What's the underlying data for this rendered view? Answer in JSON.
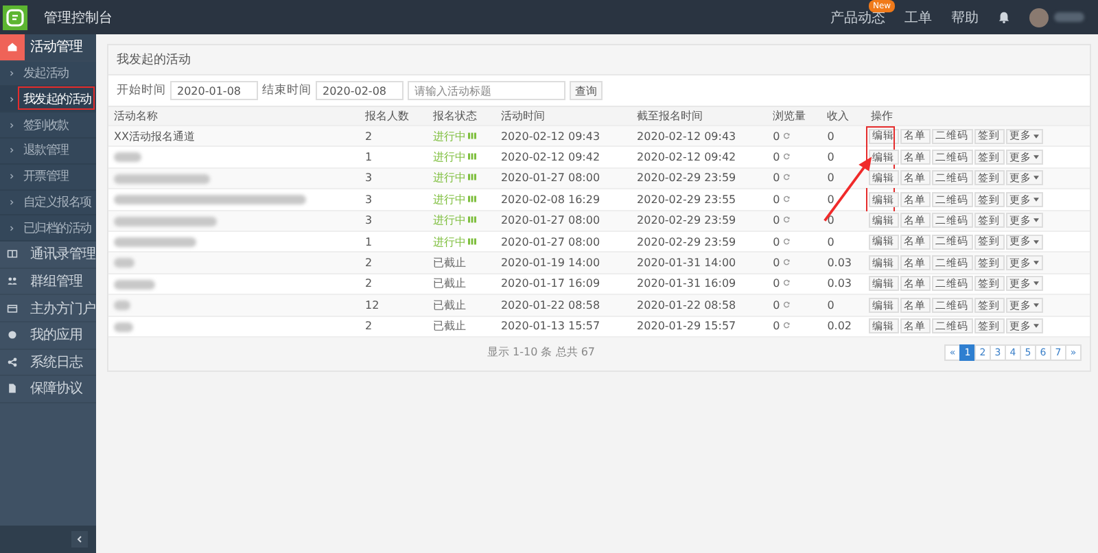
{
  "header": {
    "title": "管理控制台",
    "links": [
      {
        "label": "产品动态",
        "badge": "New"
      },
      {
        "label": "工单"
      },
      {
        "label": "帮助"
      }
    ]
  },
  "sidebar": {
    "items": [
      {
        "label": "活动管理",
        "selected": true,
        "expanded": true,
        "children": [
          {
            "label": "发起活动",
            "selected": false
          },
          {
            "label": "我发起的活动",
            "selected": true
          },
          {
            "label": "签到收款",
            "selected": false
          },
          {
            "label": "退款管理",
            "selected": false
          },
          {
            "label": "开票管理",
            "selected": false
          },
          {
            "label": "自定义报名项",
            "selected": false
          },
          {
            "label": "已归档的活动",
            "selected": false
          }
        ]
      },
      {
        "label": "通讯录管理",
        "selected": false,
        "expanded": false
      },
      {
        "label": "群组管理",
        "selected": false,
        "expanded": false
      },
      {
        "label": "主办方门户",
        "selected": false,
        "expanded": false
      },
      {
        "label": "我的应用",
        "selected": false,
        "expanded": false
      },
      {
        "label": "系统日志",
        "selected": false,
        "expanded": false
      },
      {
        "label": "保障协议",
        "selected": false,
        "expanded": false
      }
    ]
  },
  "panel": {
    "title": "我发起的活动",
    "filters": {
      "start_label": "开始时间",
      "start_value": "2020-01-08",
      "end_label": "结束时间",
      "end_value": "2020-02-08",
      "search_placeholder": "请输入活动标题",
      "search_button": "查询"
    },
    "table": {
      "columns": [
        "活动名称",
        "报名人数",
        "报名状态",
        "活动时间",
        "截至报名时间",
        "浏览量",
        "收入",
        "操作"
      ],
      "rows": [
        {
          "name": "XX活动报名通道",
          "blurred": false,
          "count": "2",
          "status": "进行中",
          "in_progress": true,
          "start": "2020-02-12 09:43",
          "deadline": "2020-02-12 09:43",
          "views": "0",
          "income": "0",
          "actions": [
            "编辑",
            "名单",
            "二维码",
            "签到",
            "更多"
          ]
        },
        {
          "blurred": true,
          "count": "1",
          "status": "进行中",
          "in_progress": true,
          "start": "2020-02-12 09:42",
          "deadline": "2020-02-12 09:42",
          "views": "0",
          "income": "0",
          "actions": [
            "编辑",
            "名单",
            "二维码",
            "签到",
            "更多"
          ]
        },
        {
          "blurred": true,
          "count": "3",
          "status": "进行中",
          "in_progress": true,
          "start": "2020-01-27 08:00",
          "deadline": "2020-02-29 23:59",
          "views": "0",
          "income": "0",
          "actions": [
            "编辑",
            "名单",
            "二维码",
            "签到",
            "更多"
          ]
        },
        {
          "blurred": true,
          "count": "3",
          "status": "进行中",
          "in_progress": true,
          "start": "2020-02-08 16:29",
          "deadline": "2020-02-29 23:55",
          "views": "0",
          "income": "0",
          "actions": [
            "编辑",
            "名单",
            "二维码",
            "签到",
            "更多"
          ]
        },
        {
          "blurred": true,
          "count": "3",
          "status": "进行中",
          "in_progress": true,
          "start": "2020-01-27 08:00",
          "deadline": "2020-02-29 23:59",
          "views": "0",
          "income": "0",
          "actions": [
            "编辑",
            "名单",
            "二维码",
            "签到",
            "更多"
          ]
        },
        {
          "blurred": true,
          "count": "1",
          "status": "进行中",
          "in_progress": true,
          "start": "2020-01-27 08:00",
          "deadline": "2020-02-29 23:59",
          "views": "0",
          "income": "0",
          "actions": [
            "编辑",
            "名单",
            "二维码",
            "签到",
            "更多"
          ]
        },
        {
          "blurred": true,
          "count": "2",
          "status": "已截止",
          "in_progress": false,
          "start": "2020-01-19 14:00",
          "deadline": "2020-01-31 14:00",
          "views": "0",
          "income": "0.03",
          "actions": [
            "编辑",
            "名单",
            "二维码",
            "签到",
            "更多"
          ]
        },
        {
          "blurred": true,
          "count": "2",
          "status": "已截止",
          "in_progress": false,
          "start": "2020-01-17 16:09",
          "deadline": "2020-01-31 16:09",
          "views": "0",
          "income": "0.03",
          "actions": [
            "编辑",
            "名单",
            "二维码",
            "签到",
            "更多"
          ]
        },
        {
          "blurred": true,
          "count": "12",
          "status": "已截止",
          "in_progress": false,
          "start": "2020-01-22 08:58",
          "deadline": "2020-01-22 08:58",
          "views": "0",
          "income": "0",
          "actions": [
            "编辑",
            "名单",
            "二维码",
            "签到",
            "更多"
          ]
        },
        {
          "blurred": true,
          "count": "2",
          "status": "已截止",
          "in_progress": false,
          "start": "2020-01-13 15:57",
          "deadline": "2020-01-29 15:57",
          "views": "0",
          "income": "0.02",
          "actions": [
            "编辑",
            "名单",
            "二维码",
            "签到",
            "更多"
          ]
        }
      ]
    },
    "summary": "显示 1-10 条 总共 67",
    "pagination": {
      "prev": "«",
      "next": "»",
      "pages": [
        {
          "label": "1",
          "selected": true
        },
        {
          "label": "2",
          "selected": false
        },
        {
          "label": "3",
          "selected": false
        },
        {
          "label": "4",
          "selected": false
        },
        {
          "label": "5",
          "selected": false
        },
        {
          "label": "6",
          "selected": false
        },
        {
          "label": "7",
          "selected": false
        }
      ]
    }
  }
}
